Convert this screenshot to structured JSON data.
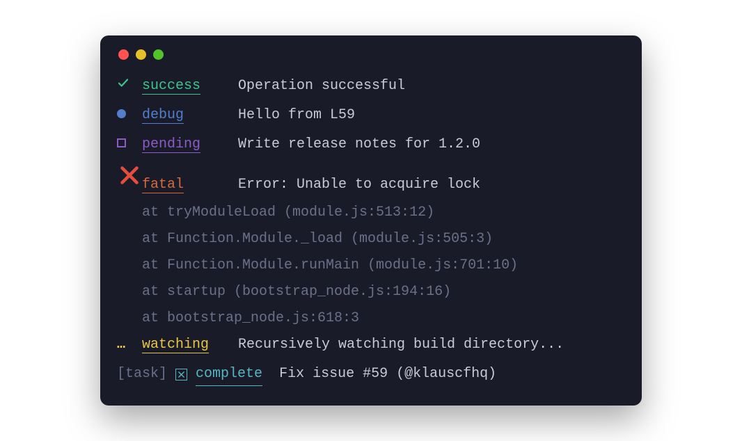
{
  "lines": {
    "success": {
      "badge": "success",
      "msg": "Operation successful"
    },
    "debug": {
      "badge": "debug",
      "msg": "Hello from L59"
    },
    "pending": {
      "badge": "pending",
      "msg": "Write release notes for 1.2.0"
    },
    "fatal": {
      "badge": "fatal",
      "msg": "Error: Unable to acquire lock"
    },
    "watching": {
      "badge": "watching",
      "msg": "Recursively watching build directory..."
    }
  },
  "trace": [
    "at tryModuleLoad (module.js:513:12)",
    "at Function.Module._load (module.js:505:3)",
    "at Function.Module.runMain (module.js:701:10)",
    "at startup (bootstrap_node.js:194:16)",
    "at bootstrap_node.js:618:3"
  ],
  "task": {
    "prefix": "[task]",
    "badge": "complete",
    "msg": "Fix issue #59 (@klauscfhq)"
  }
}
